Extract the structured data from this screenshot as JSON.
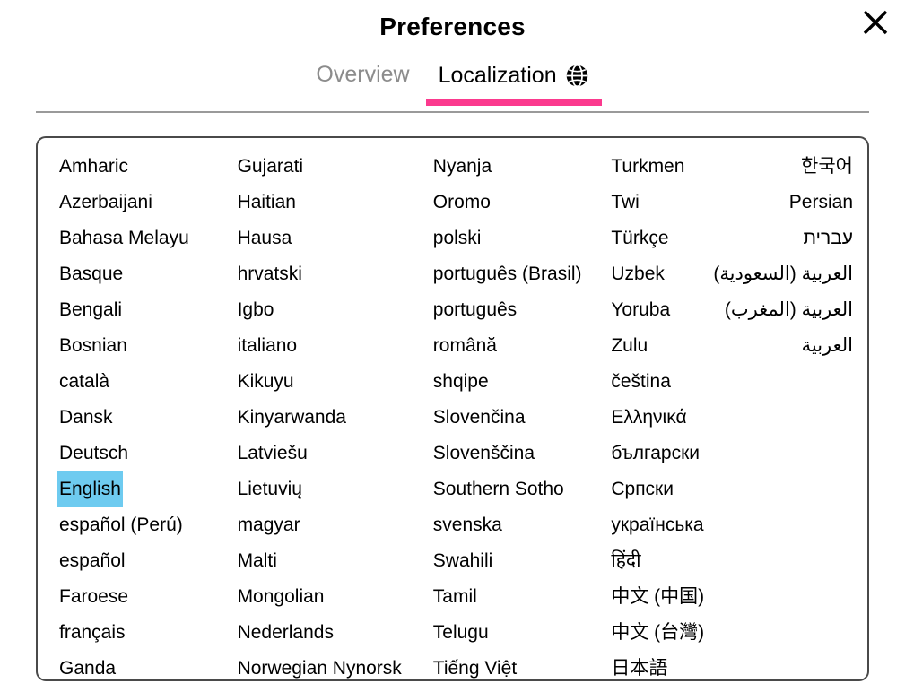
{
  "dialog": {
    "title": "Preferences",
    "close_icon": "close-icon"
  },
  "tabs": [
    {
      "label": "Overview",
      "active": false,
      "icon": null
    },
    {
      "label": "Localization",
      "active": true,
      "icon": "globe-icon"
    }
  ],
  "colors": {
    "accent_pink": "#fb3a8e",
    "selection_blue": "#6ecbf0",
    "inactive_tab_text": "#8c8c8c",
    "panel_border": "#4a4a4a",
    "tabbar_border": "#9a9a9a"
  },
  "language_list": {
    "selected": "English",
    "columns": [
      {
        "direction": "ltr",
        "items": [
          "Amharic",
          "Azerbaijani",
          "Bahasa Melayu",
          "Basque",
          "Bengali",
          "Bosnian",
          "català",
          "Dansk",
          "Deutsch",
          "English",
          "español (Perú)",
          "español",
          "Faroese",
          "français",
          "Ganda"
        ]
      },
      {
        "direction": "ltr",
        "items": [
          "Gujarati",
          "Haitian",
          "Hausa",
          "hrvatski",
          "Igbo",
          "italiano",
          "Kikuyu",
          "Kinyarwanda",
          "Latviešu",
          "Lietuvių",
          "magyar",
          "Malti",
          "Mongolian",
          "Nederlands",
          "Norwegian Nynorsk"
        ]
      },
      {
        "direction": "ltr",
        "items": [
          "Nyanja",
          "Oromo",
          "polski",
          "português (Brasil)",
          "português",
          "română",
          "shqipe",
          "Slovenčina",
          "Slovenščina",
          "Southern Sotho",
          "svenska",
          "Swahili",
          "Tamil",
          "Telugu",
          "Tiếng Việt"
        ]
      },
      {
        "direction": "ltr",
        "items": [
          "Turkmen",
          "Twi",
          "Türkçe",
          "Uzbek",
          "Yoruba",
          "Zulu",
          "čeština",
          "Ελληνικά",
          "български",
          "Српски",
          "українська",
          "हिंदी",
          "中文 (中国)",
          "中文 (台灣)",
          "日本語"
        ]
      },
      {
        "direction": "rtl",
        "items": [
          "한국어",
          "Persian",
          "עברית",
          "العربية (السعودية)",
          "العربية (المغرب)",
          "العربية"
        ]
      }
    ]
  }
}
